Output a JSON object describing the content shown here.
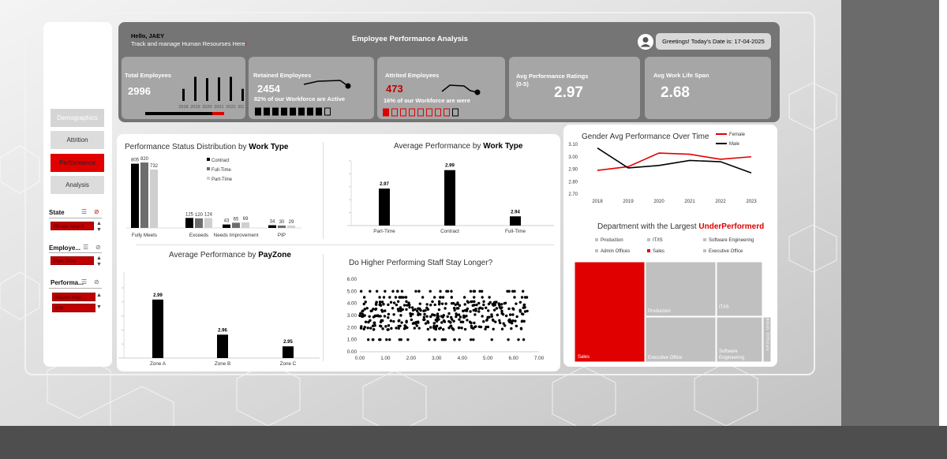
{
  "header": {
    "greeting": "Hello, JAEY",
    "subtitle": "Track and manage Human Resourses Here",
    "subtitle_mark": "!",
    "title": "Employee Performance Analysis",
    "date_text": "Greetings! Today's Date is: 17-04-2025"
  },
  "nav": {
    "demographics": "Demographics",
    "attrition": "Attrition",
    "performance": "Performance",
    "analysis": "Analysis"
  },
  "slicers": [
    {
      "title": "State",
      "items": [
        "Rhode Island"
      ]
    },
    {
      "title": "Employe...",
      "items": [
        "Part-Time"
      ]
    },
    {
      "title": "Performa...",
      "items": [
        "Needs Impr...",
        "PIP"
      ]
    }
  ],
  "kpis": {
    "total": {
      "title": "Total Employees",
      "value": "2996",
      "years": [
        "2018",
        "2019",
        "2020",
        "2021",
        "2022",
        "2023"
      ],
      "bars": [
        0.45,
        0.9,
        0.85,
        0.88,
        0.9,
        0.45
      ],
      "progress": 0.85
    },
    "retained": {
      "title": "Retained Employees",
      "value": "2454",
      "sub": "82% of our Workforce are Active",
      "boxes_filled": 8,
      "boxes_total": 9
    },
    "attrited": {
      "title": "Attrited Employees",
      "value": "473",
      "sub": "16% of our Workforce are were",
      "boxes_filled": 1,
      "boxes_total": 9
    },
    "rating": {
      "title": "Avg Performance Ratings",
      "scale": "(0-5)",
      "value": "2.97"
    },
    "lifespan": {
      "title": "Avg Work Life Span",
      "value": "2.68"
    }
  },
  "colors": {
    "accent_red": "#e00000",
    "dark_grey": "#757575",
    "black": "#000000"
  },
  "chart_data": [
    {
      "type": "bar",
      "title": "Performance Status Distribution by",
      "title_bold": "Work Type",
      "categories": [
        "Fully Meets",
        "Exceeds",
        "Needs Improvement",
        "PIP"
      ],
      "series": [
        {
          "name": "Contract",
          "values": [
            805,
            125,
            43,
            34
          ],
          "color": "#000000"
        },
        {
          "name": "Full-Time",
          "values": [
            820,
            120,
            65,
            30
          ],
          "color": "#6d6d6d"
        },
        {
          "name": "Part-Time",
          "values": [
            732,
            124,
            69,
            29
          ],
          "color": "#cfcfcf"
        }
      ]
    },
    {
      "type": "bar",
      "title": "Average Performance by",
      "title_bold": "Work Type",
      "categories": [
        "Part-Time",
        "Contract",
        "Full-Time"
      ],
      "values": [
        2.97,
        2.99,
        2.94
      ]
    },
    {
      "type": "bar",
      "title": "Average Performance by",
      "title_bold": "PayZone",
      "categories": [
        "Zone A",
        "Zone B",
        "Zone C"
      ],
      "values": [
        2.99,
        2.96,
        2.95
      ]
    },
    {
      "type": "scatter",
      "title": "Do Higher Performing Staff Stay Longer?",
      "x_ticks": [
        "0.00",
        "1.00",
        "2.00",
        "3.00",
        "4.00",
        "5.00",
        "6.00",
        "7.00"
      ],
      "y_ticks": [
        "0.00",
        "1.00",
        "2.00",
        "3.00",
        "4.00",
        "5.00",
        "6.00"
      ],
      "xlim": [
        0,
        7
      ],
      "ylim": [
        0,
        6
      ],
      "x_range_points": [
        0,
        6.6
      ],
      "y_levels": [
        1,
        2,
        2.5,
        3,
        3.5,
        4,
        4.5,
        5
      ]
    },
    {
      "type": "line",
      "title": "Gender Avg Performance Over Time",
      "categories": [
        "2018",
        "2019",
        "2020",
        "2021",
        "2022",
        "2023"
      ],
      "y_ticks": [
        "2.70",
        "2.80",
        "2.90",
        "3.00",
        "3.10"
      ],
      "ylim": [
        2.7,
        3.1
      ],
      "series": [
        {
          "name": "Female",
          "values": [
            2.89,
            2.92,
            3.03,
            3.02,
            2.98,
            3.0
          ],
          "color": "#e00000"
        },
        {
          "name": "Male",
          "values": [
            3.07,
            2.91,
            2.93,
            2.97,
            2.96,
            2.87
          ],
          "color": "#000000"
        }
      ]
    },
    {
      "type": "treemap",
      "title": "Department with the Largest",
      "title_red": "UnderPerformerd",
      "legend": [
        {
          "name": "Production",
          "color": "#c0c0c0"
        },
        {
          "name": "IT/IS",
          "color": "#c0c0c0"
        },
        {
          "name": "Software Engineering",
          "color": "#c0c0c0"
        },
        {
          "name": "Admin Offices",
          "color": "#c0c0c0"
        },
        {
          "name": "Sales",
          "color": "#e00000"
        },
        {
          "name": "Executive Office",
          "color": "#c0c0c0"
        }
      ],
      "cells": [
        {
          "name": "Sales",
          "color": "#e00000"
        },
        {
          "name": "Production",
          "color": "#c0c0c0"
        },
        {
          "name": "Executive Office",
          "color": "#c0c0c0"
        },
        {
          "name": "IT/IS",
          "color": "#c0c0c0"
        },
        {
          "name": "Software Engineering",
          "color": "#c0c0c0"
        },
        {
          "name": "Admin Offices",
          "color": "#c0c0c0"
        }
      ]
    }
  ]
}
